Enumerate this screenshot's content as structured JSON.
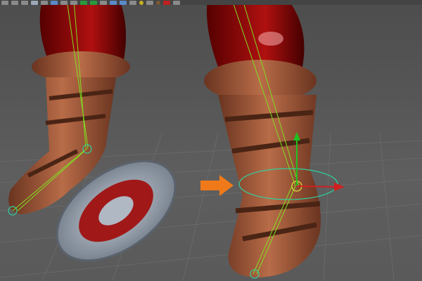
{
  "viewport": {
    "toolbar_icons": [
      "select-icon",
      "lasso-icon",
      "paint-icon",
      "camera-icon",
      "wireframe-icon",
      "grid-icon",
      "shaded-icon",
      "smooth-icon",
      "textured-icon",
      "isolate-icon",
      "xray-icon",
      "joints-icon",
      "lights-icon",
      "shadows-icon",
      "material-icon",
      "ambient-occlusion-icon",
      "motion-blur-icon",
      "gate-icon",
      "resolution-icon"
    ],
    "colors": {
      "boot": "#a8603e",
      "pants": "#a01010",
      "rig": "#80e020",
      "manipulator": "#30d0a0",
      "arrow": "#f07a1a",
      "shield": "#9aa4b0"
    }
  }
}
